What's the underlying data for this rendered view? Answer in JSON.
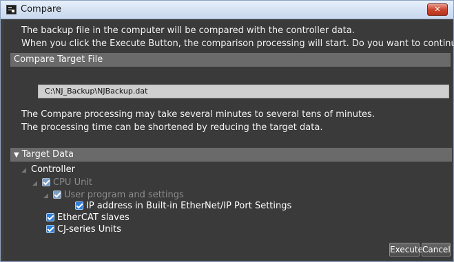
{
  "window": {
    "title": "Compare",
    "close_glyph": "✕"
  },
  "intro": {
    "line1": "The backup file in the computer will be compared with the controller data.",
    "line2": "When you click the Execute Button, the comparison processing will start. Do you want to continue?"
  },
  "compare_target": {
    "header": "Compare Target File",
    "path": "C:\\NJ_Backup\\NJBackup.dat"
  },
  "notice": {
    "line1": "The Compare processing may take several minutes to several tens of minutes.",
    "line2": "The processing time can be shortened by reducing the target data."
  },
  "target_data": {
    "header": "Target Data",
    "expand_glyph": "▼",
    "tree": {
      "controller": "Controller",
      "cpu_unit": "CPU Unit",
      "user_program": "User program and settings",
      "ip_address": "IP address in Built-in EtherNet/IP Port Settings",
      "ethercat": "EtherCAT slaves",
      "cj_series": "CJ-series Units"
    },
    "expander_glyph": "◢"
  },
  "buttons": {
    "execute": "Execute",
    "cancel": "Cancel"
  },
  "colors": {
    "background": "#3a3a3a",
    "section_header": "#6a6a6a",
    "checkbox_accent": "#2f7fd8",
    "close_button": "#c9462f"
  }
}
